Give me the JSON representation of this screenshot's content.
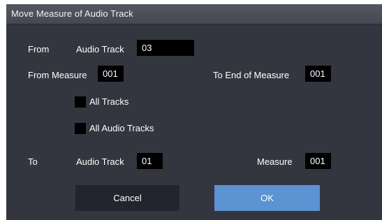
{
  "dialog": {
    "title": "Move Measure of Audio Track"
  },
  "from": {
    "label": "From",
    "audio_track_label": "Audio Track",
    "audio_track_value": "03",
    "from_measure_label": "From Measure",
    "from_measure_value": "001",
    "to_end_label": "To End of Measure",
    "to_end_value": "001"
  },
  "options": {
    "all_tracks_label": "All Tracks",
    "all_tracks_checked": false,
    "all_audio_tracks_label": "All Audio Tracks",
    "all_audio_tracks_checked": false
  },
  "to": {
    "label": "To",
    "audio_track_label": "Audio Track",
    "audio_track_value": "01",
    "measure_label": "Measure",
    "measure_value": "001"
  },
  "buttons": {
    "cancel": "Cancel",
    "ok": "OK"
  },
  "colors": {
    "dialog_bg": "#33363e",
    "field_bg": "#000000",
    "cancel_bg": "#22252d",
    "ok_bg": "#5b93d3"
  }
}
